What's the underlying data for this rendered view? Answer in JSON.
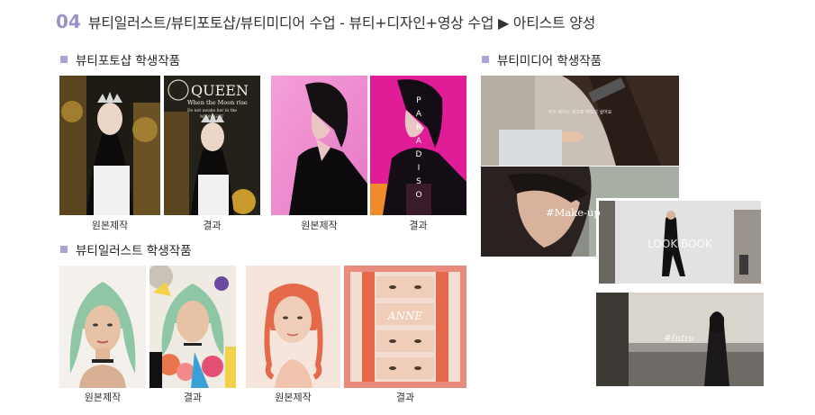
{
  "header": {
    "number": "04",
    "title": "뷰티일러스트/뷰티포토샵/뷰티미디어 수업 - 뷰티+디자인+영상 수업 ▶ 아티스트 양성"
  },
  "sections": {
    "photoshop": {
      "title": "뷰티포토샵 학생작품"
    },
    "illust": {
      "title": "뷰티일러스트 학생작품"
    },
    "media": {
      "title": "뷰티미디어 학생작품"
    }
  },
  "captions": {
    "original": "원본제작",
    "result": "결과"
  },
  "overlays": {
    "queen_title": "QUEEN",
    "queen_sub1": "When the Moon rise",
    "queen_sub2": "Do not awake her in the",
    "queen_sub3": "MIDNIGHT",
    "paradiso": "PARADISO",
    "anne": "ANNE",
    "makeup": "#Make-up",
    "lookbook": "LOOK BOOK",
    "intro": "#Intro",
    "subtitle": "저의 헤어는 최고로 해보고 싶어요"
  },
  "colors": {
    "accent": "#9a93c9",
    "bullet": "#aaa3d3",
    "pink": "#f07fbf",
    "magenta": "#e0229a",
    "salmon": "#e98b7d"
  }
}
